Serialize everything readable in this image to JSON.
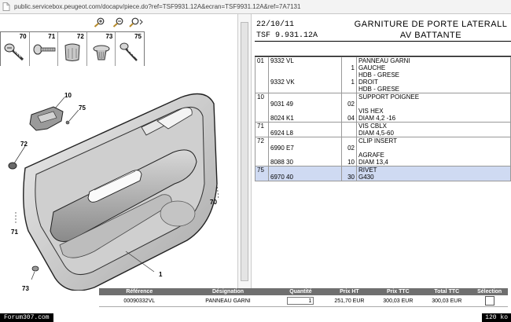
{
  "browser": {
    "url": "public.servicebox.peugeot.com/docapv/piece.do?ref=TSF9931.12A&ecran=TSF9931.12A&ref=7A7131"
  },
  "parts_strip": [
    {
      "number": "70",
      "icon": "screw-icon"
    },
    {
      "number": "71",
      "icon": "bolt-icon"
    },
    {
      "number": "72",
      "icon": "clip-insert-icon"
    },
    {
      "number": "73",
      "icon": "rivet-icon"
    },
    {
      "number": "75",
      "icon": "screw-long-icon"
    }
  ],
  "diagram": {
    "callouts": [
      "10",
      "75",
      "72",
      "70",
      "71",
      "1",
      "73"
    ]
  },
  "header": {
    "date": "22/10/11",
    "code": "TSF 9.931.12A",
    "title_line1": "GARNITURE DE PORTE LATERALL",
    "title_line2": "AV BATTANTE"
  },
  "parts_list": [
    {
      "item": "01",
      "refs": [
        "9332 VL",
        "",
        "",
        "9332 VK"
      ],
      "qty": [
        "1",
        "",
        "",
        "1"
      ],
      "desc": [
        "PANNEAU GARNI",
        "GAUCHE",
        "HDB - GRESE",
        "DROIT",
        "HDB - GRESE"
      ],
      "selected": false
    },
    {
      "item": "10",
      "refs": [
        "9031 49",
        "",
        "8024 K1"
      ],
      "qty": [
        "02",
        "",
        "04"
      ],
      "desc": [
        "SUPPORT POIGNEE",
        "",
        "VIS HEX",
        "DIAM 4,2 -16"
      ],
      "selected": false
    },
    {
      "item": "71",
      "refs": [
        "6924 L8"
      ],
      "qty": [
        "",
        ""
      ],
      "desc": [
        "VIS CBLX",
        "DIAM 4,5-60"
      ],
      "selected": false
    },
    {
      "item": "72",
      "refs": [
        "6990 E7",
        "",
        "8088 30"
      ],
      "qty": [
        "02",
        "",
        "10"
      ],
      "desc": [
        "CLIP INSERT",
        "",
        "AGRAFE",
        "DIAM 13,4"
      ],
      "selected": false
    },
    {
      "item": "75",
      "refs": [
        "6970 40"
      ],
      "qty": [
        "30"
      ],
      "desc": [
        "RIVET",
        "G430"
      ],
      "selected": true
    }
  ],
  "order_table": {
    "headers": [
      "Référence",
      "Désignation",
      "Quantité",
      "Prix HT",
      "Prix TTC",
      "Total TTC",
      "Sélection"
    ],
    "row": {
      "reference": "00090332VL",
      "designation": "PANNEAU GARNI",
      "quantity": "1",
      "prix_ht": "251,70 EUR",
      "prix_ttc": "300,03 EUR",
      "total_ttc": "300,03 EUR"
    }
  },
  "footer": {
    "watermark": "Forum307.com",
    "size": "120 ko"
  }
}
